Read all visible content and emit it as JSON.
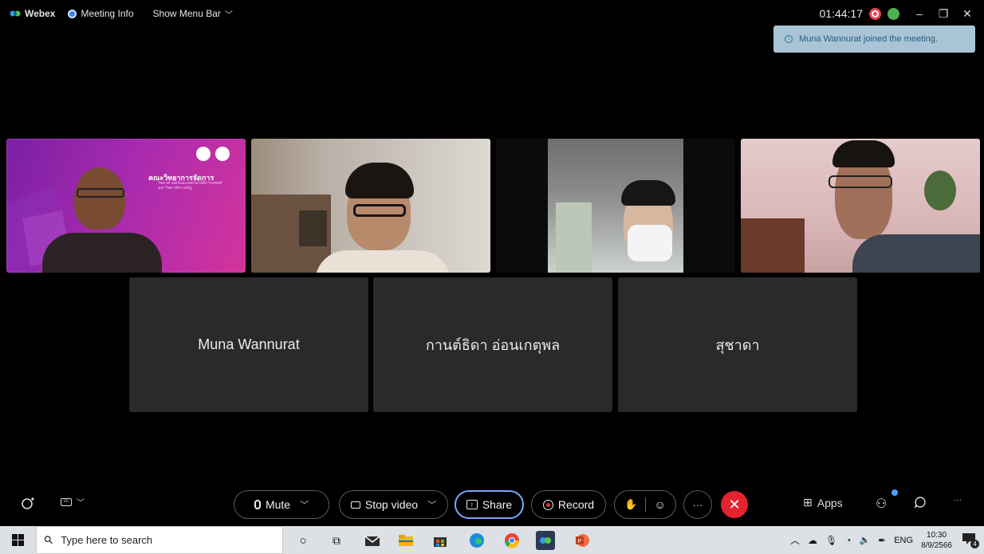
{
  "topbar": {
    "app_name": "Webex",
    "meeting_info": "Meeting Info",
    "show_menu_bar": "Show Menu Bar",
    "timer": "01:44:17",
    "minimize": "–",
    "restore": "❐",
    "close": "✕"
  },
  "toast": {
    "message": "Muna Wannurat joined the meeting."
  },
  "video_tiles": [
    {
      "slide_title": "คณะวิทยาการจัดการ",
      "slide_subtitle": "วิทยาศาสตร์และเทคโนโลยีการแพทย์ มหาวิทยาลัยราชภัฏ"
    }
  ],
  "name_tiles": [
    {
      "name": "Muna Wannurat"
    },
    {
      "name": "กานต์ธิดา อ่อนเกตุพล"
    },
    {
      "name": "สุชาดา"
    }
  ],
  "controls": {
    "mute": "Mute",
    "stop_video": "Stop video",
    "share": "Share",
    "record": "Record",
    "more": "···",
    "apps": "Apps"
  },
  "taskbar": {
    "search_placeholder": "Type here to search",
    "lang": "ENG",
    "time": "10:30",
    "date": "8/9/2566",
    "notification_count": "4"
  },
  "colors": {
    "end_call": "#e2242f",
    "share_border": "#79a7ff",
    "toast_bg": "#a9c4d4",
    "slide_purple": "#a62ab0"
  }
}
